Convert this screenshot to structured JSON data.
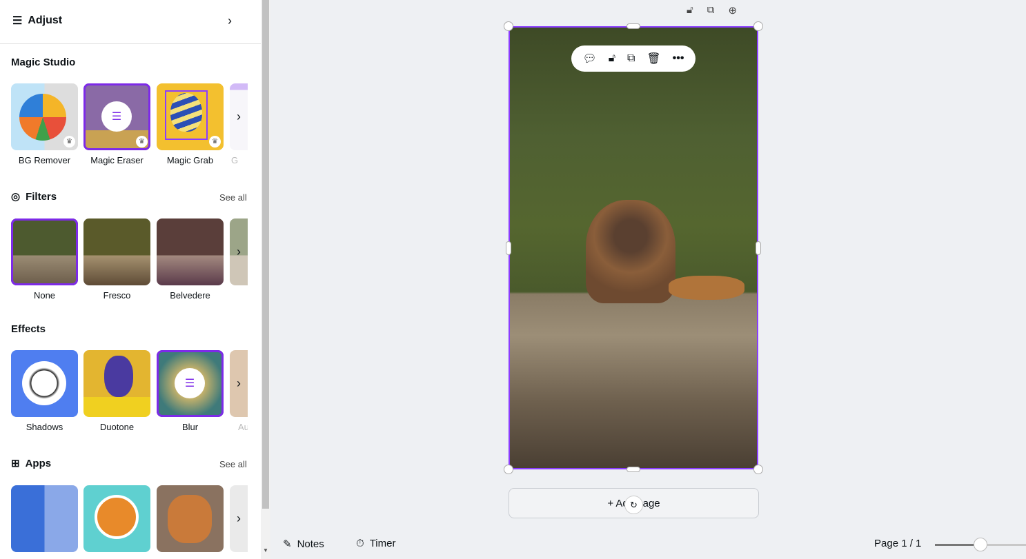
{
  "panel": {
    "adjust_label": "Adjust",
    "magic_studio": {
      "title": "Magic Studio",
      "items": [
        {
          "label": "BG Remover",
          "premium": true
        },
        {
          "label": "Magic Eraser",
          "premium": true,
          "selected": true
        },
        {
          "label": "Magic Grab",
          "premium": true
        },
        {
          "label": "G"
        }
      ]
    },
    "filters": {
      "title": "Filters",
      "see_all": "See all",
      "items": [
        {
          "label": "None",
          "selected": true
        },
        {
          "label": "Fresco"
        },
        {
          "label": "Belvedere"
        }
      ]
    },
    "effects": {
      "title": "Effects",
      "items": [
        {
          "label": "Shadows"
        },
        {
          "label": "Duotone"
        },
        {
          "label": "Blur",
          "selected": true
        },
        {
          "label": "Au"
        }
      ]
    },
    "apps": {
      "title": "Apps",
      "see_all": "See all"
    }
  },
  "canvas": {
    "add_page": "+ Add page",
    "accent": "#8b3dff"
  },
  "footer": {
    "notes": "Notes",
    "timer": "Timer",
    "page": "Page 1 / 1",
    "zoom_fraction": 0.5
  }
}
